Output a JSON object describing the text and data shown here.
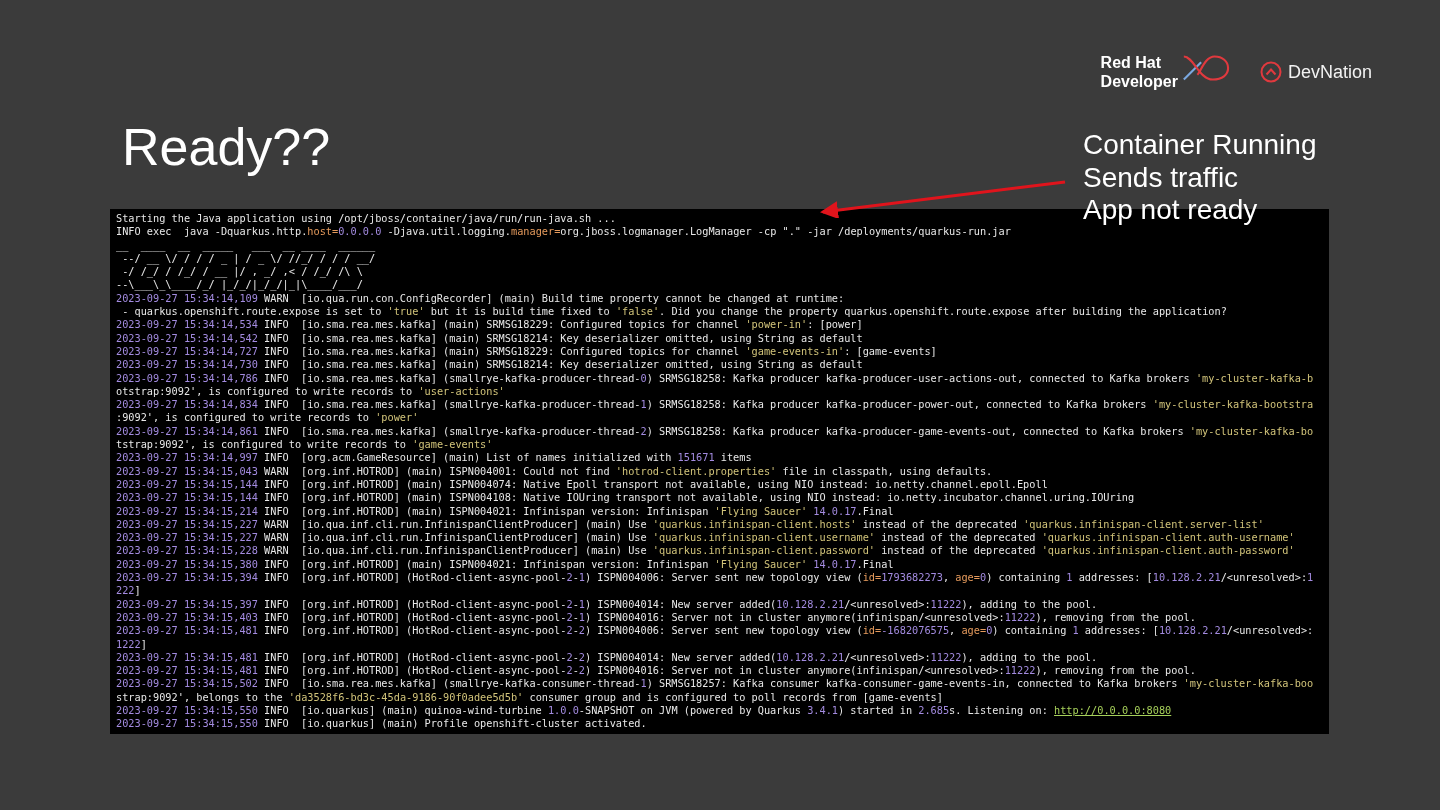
{
  "logos": {
    "developer": {
      "line_1": "Red Hat",
      "line_2": "Developer"
    },
    "devnation": "DevNation"
  },
  "title": "Ready??",
  "annotation": [
    "Container Running",
    "Sends traffic",
    "App not ready"
  ],
  "terminal": {
    "lines": [
      {
        "kind": "text",
        "segments": [
          {
            "text": "Starting the Java application using /opt/jboss/container/java/run/run-java.sh ...",
            "kind": "plain"
          }
        ]
      },
      {
        "kind": "text",
        "segments": [
          {
            "text": "INFO exec  java -Dquarkus.http.",
            "kind": "plain"
          },
          {
            "text": "host=",
            "kind": "key"
          },
          {
            "text": "0.0.0.0",
            "kind": "number"
          },
          {
            "text": " -Djava.util.logging.",
            "kind": "plain"
          },
          {
            "text": "manager=",
            "kind": "key"
          },
          {
            "text": "org.jboss.logmanager.LogManager -cp \".\" -jar /deployments/quarkus-run.jar",
            "kind": "plain"
          }
        ]
      },
      {
        "kind": "banner",
        "segments": [
          {
            "text": "__  ____  __  _____   ___  __ ____  ______",
            "kind": "plain"
          }
        ]
      },
      {
        "kind": "banner",
        "segments": [
          {
            "text": " --/ __ \\/ / / / _ | / _ \\/ //_/ / / / __/",
            "kind": "plain"
          }
        ]
      },
      {
        "kind": "banner",
        "segments": [
          {
            "text": " -/ /_/ / /_/ / __ |/ , _/ ,< / /_/ /\\ \\",
            "kind": "plain"
          }
        ]
      },
      {
        "kind": "banner",
        "segments": [
          {
            "text": "--\\___\\_\\____/_/ |_/_/|_/_/|_|\\____/___/",
            "kind": "plain"
          }
        ]
      },
      {
        "kind": "log",
        "time": "2023-09-27 15:34:14,109",
        "level": "WARN",
        "segments": [
          {
            "text": "[io.qua.run.con.ConfigRecorder] (main) Build time property cannot be changed at runtime:",
            "kind": "plain"
          }
        ]
      },
      {
        "kind": "text",
        "segments": [
          {
            "text": " - quarkus.openshift.route.expose is set to ",
            "kind": "plain"
          },
          {
            "text": "'true'",
            "kind": "string"
          },
          {
            "text": " but it is build time fixed to ",
            "kind": "plain"
          },
          {
            "text": "'false'",
            "kind": "string"
          },
          {
            "text": ". Did you change the property quarkus.openshift.route.expose after building the application?",
            "kind": "plain"
          }
        ]
      },
      {
        "kind": "log",
        "time": "2023-09-27 15:34:14,534",
        "level": "INFO",
        "segments": [
          {
            "text": "[io.sma.rea.mes.kafka] (main) SRMSG18229: Configured topics for channel ",
            "kind": "plain"
          },
          {
            "text": "'power-in'",
            "kind": "string"
          },
          {
            "text": ": [power]",
            "kind": "plain"
          }
        ]
      },
      {
        "kind": "log",
        "time": "2023-09-27 15:34:14,542",
        "level": "INFO",
        "segments": [
          {
            "text": "[io.sma.rea.mes.kafka] (main) SRMSG18214: Key deserializer omitted, using String as default",
            "kind": "plain"
          }
        ]
      },
      {
        "kind": "log",
        "time": "2023-09-27 15:34:14,727",
        "level": "INFO",
        "segments": [
          {
            "text": "[io.sma.rea.mes.kafka] (main) SRMSG18229: Configured topics for channel ",
            "kind": "plain"
          },
          {
            "text": "'game-events-in'",
            "kind": "string"
          },
          {
            "text": ": [game-events]",
            "kind": "plain"
          }
        ]
      },
      {
        "kind": "log",
        "time": "2023-09-27 15:34:14,730",
        "level": "INFO",
        "segments": [
          {
            "text": "[io.sma.rea.mes.kafka] (main) SRMSG18214: Key deserializer omitted, using String as default",
            "kind": "plain"
          }
        ]
      },
      {
        "kind": "log",
        "time": "2023-09-27 15:34:14,786",
        "level": "INFO",
        "segments": [
          {
            "text": "[io.sma.rea.mes.kafka] (smallrye-kafka-producer-thread-",
            "kind": "plain"
          },
          {
            "text": "0",
            "kind": "number"
          },
          {
            "text": ") SRMSG18258: Kafka producer kafka-producer-user-actions-out, connected to Kafka brokers ",
            "kind": "plain"
          },
          {
            "text": "'my-cluster-kafka-b",
            "kind": "string"
          }
        ]
      },
      {
        "kind": "text",
        "segments": [
          {
            "text": "otstrap:9092', is configured to write records to ",
            "kind": "plain"
          },
          {
            "text": "'user-actions'",
            "kind": "string"
          }
        ]
      },
      {
        "kind": "log",
        "time": "2023-09-27 15:34:14,834",
        "level": "INFO",
        "segments": [
          {
            "text": "[io.sma.rea.mes.kafka] (smallrye-kafka-producer-thread-",
            "kind": "plain"
          },
          {
            "text": "1",
            "kind": "number"
          },
          {
            "text": ") SRMSG18258: Kafka producer kafka-producer-power-out, connected to Kafka brokers ",
            "kind": "plain"
          },
          {
            "text": "'my-cluster-kafka-bootstra",
            "kind": "string"
          }
        ]
      },
      {
        "kind": "text",
        "segments": [
          {
            "text": ":9092', is configured to write records to ",
            "kind": "plain"
          },
          {
            "text": "'power'",
            "kind": "string"
          }
        ]
      },
      {
        "kind": "log",
        "time": "2023-09-27 15:34:14,861",
        "level": "INFO",
        "segments": [
          {
            "text": "[io.sma.rea.mes.kafka] (smallrye-kafka-producer-thread-",
            "kind": "plain"
          },
          {
            "text": "2",
            "kind": "number"
          },
          {
            "text": ") SRMSG18258: Kafka producer kafka-producer-game-events-out, connected to Kafka brokers ",
            "kind": "plain"
          },
          {
            "text": "'my-cluster-kafka-bo",
            "kind": "string"
          }
        ]
      },
      {
        "kind": "text",
        "segments": [
          {
            "text": "tstrap:9092', is configured to write records to ",
            "kind": "plain"
          },
          {
            "text": "'game-events'",
            "kind": "string"
          }
        ]
      },
      {
        "kind": "log",
        "time": "2023-09-27 15:34:14,997",
        "level": "INFO",
        "segments": [
          {
            "text": "[org.acm.GameResource] (main) List of names initialized with ",
            "kind": "plain"
          },
          {
            "text": "151671",
            "kind": "number"
          },
          {
            "text": " items",
            "kind": "plain"
          }
        ]
      },
      {
        "kind": "log",
        "time": "2023-09-27 15:34:15,043",
        "level": "WARN",
        "segments": [
          {
            "text": "[org.inf.HOTROD] (main) ISPN004001: Could not find ",
            "kind": "plain"
          },
          {
            "text": "'hotrod-client.properties'",
            "kind": "string"
          },
          {
            "text": " file in classpath, using defaults.",
            "kind": "plain"
          }
        ]
      },
      {
        "kind": "log",
        "time": "2023-09-27 15:34:15,144",
        "level": "INFO",
        "segments": [
          {
            "text": "[org.inf.HOTROD] (main) ISPN004074: Native Epoll transport not available, using NIO instead: io.netty.channel.epoll.Epoll",
            "kind": "plain"
          }
        ]
      },
      {
        "kind": "log",
        "time": "2023-09-27 15:34:15,144",
        "level": "INFO",
        "segments": [
          {
            "text": "[org.inf.HOTROD] (main) ISPN004108: Native IOUring transport not available, using NIO instead: io.netty.incubator.channel.uring.IOUring",
            "kind": "plain"
          }
        ]
      },
      {
        "kind": "log",
        "time": "2023-09-27 15:34:15,214",
        "level": "INFO",
        "segments": [
          {
            "text": "[org.inf.HOTROD] (main) ISPN004021: Infinispan version: Infinispan ",
            "kind": "plain"
          },
          {
            "text": "'Flying Saucer'",
            "kind": "string"
          },
          {
            "text": " 14.0.17",
            "kind": "number"
          },
          {
            "text": ".Final",
            "kind": "plain"
          }
        ]
      },
      {
        "kind": "log",
        "time": "2023-09-27 15:34:15,227",
        "level": "WARN",
        "segments": [
          {
            "text": "[io.qua.inf.cli.run.InfinispanClientProducer] (main) Use ",
            "kind": "plain"
          },
          {
            "text": "'quarkus.infinispan-client.hosts'",
            "kind": "string"
          },
          {
            "text": " instead of the deprecated ",
            "kind": "plain"
          },
          {
            "text": "'quarkus.infinispan-client.server-list'",
            "kind": "string"
          }
        ]
      },
      {
        "kind": "log",
        "time": "2023-09-27 15:34:15,227",
        "level": "WARN",
        "segments": [
          {
            "text": "[io.qua.inf.cli.run.InfinispanClientProducer] (main) Use ",
            "kind": "plain"
          },
          {
            "text": "'quarkus.infinispan-client.username'",
            "kind": "string"
          },
          {
            "text": " instead of the deprecated ",
            "kind": "plain"
          },
          {
            "text": "'quarkus.infinispan-client.auth-username'",
            "kind": "string"
          }
        ]
      },
      {
        "kind": "log",
        "time": "2023-09-27 15:34:15,228",
        "level": "WARN",
        "segments": [
          {
            "text": "[io.qua.inf.cli.run.InfinispanClientProducer] (main) Use ",
            "kind": "plain"
          },
          {
            "text": "'quarkus.infinispan-client.password'",
            "kind": "string"
          },
          {
            "text": " instead of the deprecated ",
            "kind": "plain"
          },
          {
            "text": "'quarkus.infinispan-client.auth-password'",
            "kind": "string"
          }
        ]
      },
      {
        "kind": "log",
        "time": "2023-09-27 15:34:15,380",
        "level": "INFO",
        "segments": [
          {
            "text": "[org.inf.HOTROD] (main) ISPN004021: Infinispan version: Infinispan ",
            "kind": "plain"
          },
          {
            "text": "'Flying Saucer'",
            "kind": "string"
          },
          {
            "text": " 14.0.17",
            "kind": "number"
          },
          {
            "text": ".Final",
            "kind": "plain"
          }
        ]
      },
      {
        "kind": "log",
        "time": "2023-09-27 15:34:15,394",
        "level": "INFO",
        "segments": [
          {
            "text": "[org.inf.HOTROD] (HotRod-client-async-pool-",
            "kind": "plain"
          },
          {
            "text": "2",
            "kind": "number"
          },
          {
            "text": "-",
            "kind": "plain"
          },
          {
            "text": "1",
            "kind": "number"
          },
          {
            "text": ") ISPN004006: Server sent new topology view (",
            "kind": "plain"
          },
          {
            "text": "id=",
            "kind": "key"
          },
          {
            "text": "1793682273",
            "kind": "number"
          },
          {
            "text": ", ",
            "kind": "plain"
          },
          {
            "text": "age=",
            "kind": "key"
          },
          {
            "text": "0",
            "kind": "number"
          },
          {
            "text": ") containing ",
            "kind": "plain"
          },
          {
            "text": "1",
            "kind": "number"
          },
          {
            "text": " addresses: [",
            "kind": "plain"
          },
          {
            "text": "10.128.2.21",
            "kind": "number"
          },
          {
            "text": "/<unresolved>:",
            "kind": "plain"
          },
          {
            "text": "1",
            "kind": "number"
          }
        ]
      },
      {
        "kind": "text",
        "segments": [
          {
            "text": "222",
            "kind": "number"
          },
          {
            "text": "]",
            "kind": "plain"
          }
        ]
      },
      {
        "kind": "log",
        "time": "2023-09-27 15:34:15,397",
        "level": "INFO",
        "segments": [
          {
            "text": "[org.inf.HOTROD] (HotRod-client-async-pool-",
            "kind": "plain"
          },
          {
            "text": "2",
            "kind": "number"
          },
          {
            "text": "-",
            "kind": "plain"
          },
          {
            "text": "1",
            "kind": "number"
          },
          {
            "text": ") ISPN004014: New server added(",
            "kind": "plain"
          },
          {
            "text": "10.128.2.21",
            "kind": "number"
          },
          {
            "text": "/<unresolved>:",
            "kind": "plain"
          },
          {
            "text": "11222",
            "kind": "number"
          },
          {
            "text": "), adding to the pool.",
            "kind": "plain"
          }
        ]
      },
      {
        "kind": "log",
        "time": "2023-09-27 15:34:15,403",
        "level": "INFO",
        "segments": [
          {
            "text": "[org.inf.HOTROD] (HotRod-client-async-pool-",
            "kind": "plain"
          },
          {
            "text": "2",
            "kind": "number"
          },
          {
            "text": "-",
            "kind": "plain"
          },
          {
            "text": "1",
            "kind": "number"
          },
          {
            "text": ") ISPN004016: Server not in cluster anymore(infinispan/<unresolved>:",
            "kind": "plain"
          },
          {
            "text": "11222",
            "kind": "number"
          },
          {
            "text": "), removing from the pool.",
            "kind": "plain"
          }
        ]
      },
      {
        "kind": "log",
        "time": "2023-09-27 15:34:15,481",
        "level": "INFO",
        "segments": [
          {
            "text": "[org.inf.HOTROD] (HotRod-client-async-pool-",
            "kind": "plain"
          },
          {
            "text": "2",
            "kind": "number"
          },
          {
            "text": "-",
            "kind": "plain"
          },
          {
            "text": "2",
            "kind": "number"
          },
          {
            "text": ") ISPN004006: Server sent new topology view (",
            "kind": "plain"
          },
          {
            "text": "id=",
            "kind": "key"
          },
          {
            "text": "-1682076575",
            "kind": "number"
          },
          {
            "text": ", ",
            "kind": "plain"
          },
          {
            "text": "age=",
            "kind": "key"
          },
          {
            "text": "0",
            "kind": "number"
          },
          {
            "text": ") containing ",
            "kind": "plain"
          },
          {
            "text": "1",
            "kind": "number"
          },
          {
            "text": " addresses: [",
            "kind": "plain"
          },
          {
            "text": "10.128.2.21",
            "kind": "number"
          },
          {
            "text": "/<unresolved>:",
            "kind": "plain"
          }
        ]
      },
      {
        "kind": "text",
        "segments": [
          {
            "text": "1222",
            "kind": "number"
          },
          {
            "text": "]",
            "kind": "plain"
          }
        ]
      },
      {
        "kind": "log",
        "time": "2023-09-27 15:34:15,481",
        "level": "INFO",
        "segments": [
          {
            "text": "[org.inf.HOTROD] (HotRod-client-async-pool-",
            "kind": "plain"
          },
          {
            "text": "2",
            "kind": "number"
          },
          {
            "text": "-",
            "kind": "plain"
          },
          {
            "text": "2",
            "kind": "number"
          },
          {
            "text": ") ISPN004014: New server added(",
            "kind": "plain"
          },
          {
            "text": "10.128.2.21",
            "kind": "number"
          },
          {
            "text": "/<unresolved>:",
            "kind": "plain"
          },
          {
            "text": "11222",
            "kind": "number"
          },
          {
            "text": "), adding to the pool.",
            "kind": "plain"
          }
        ]
      },
      {
        "kind": "log",
        "time": "2023-09-27 15:34:15,481",
        "level": "INFO",
        "segments": [
          {
            "text": "[org.inf.HOTROD] (HotRod-client-async-pool-",
            "kind": "plain"
          },
          {
            "text": "2",
            "kind": "number"
          },
          {
            "text": "-",
            "kind": "plain"
          },
          {
            "text": "2",
            "kind": "number"
          },
          {
            "text": ") ISPN004016: Server not in cluster anymore(infinispan/<unresolved>:",
            "kind": "plain"
          },
          {
            "text": "11222",
            "kind": "number"
          },
          {
            "text": "), removing from the pool.",
            "kind": "plain"
          }
        ]
      },
      {
        "kind": "log",
        "time": "2023-09-27 15:34:15,502",
        "level": "INFO",
        "segments": [
          {
            "text": "[io.sma.rea.mes.kafka] (smallrye-kafka-consumer-thread-",
            "kind": "plain"
          },
          {
            "text": "1",
            "kind": "number"
          },
          {
            "text": ") SRMSG18257: Kafka consumer kafka-consumer-game-events-in, connected to Kafka brokers ",
            "kind": "plain"
          },
          {
            "text": "'my-cluster-kafka-boo",
            "kind": "string"
          }
        ]
      },
      {
        "kind": "text",
        "segments": [
          {
            "text": "strap:9092', belongs to the ",
            "kind": "plain"
          },
          {
            "text": "'da3528f6-bd3c-45da-9186-90f0adee5d5b'",
            "kind": "string"
          },
          {
            "text": " consumer group and is configured to poll records from [game-events]",
            "kind": "plain"
          }
        ]
      },
      {
        "kind": "log",
        "time": "2023-09-27 15:34:15,550",
        "level": "INFO",
        "segments": [
          {
            "text": "[io.quarkus] (main) quinoa-wind-turbine ",
            "kind": "plain"
          },
          {
            "text": "1.0.0",
            "kind": "number"
          },
          {
            "text": "-SNAPSHOT on JVM (powered by Quarkus ",
            "kind": "plain"
          },
          {
            "text": "3.4.1",
            "kind": "number"
          },
          {
            "text": ") started in ",
            "kind": "plain"
          },
          {
            "text": "2.685",
            "kind": "number"
          },
          {
            "text": "s. Listening on: ",
            "kind": "plain"
          },
          {
            "text": "http://0.0.0.0:8080",
            "kind": "link"
          }
        ]
      },
      {
        "kind": "log",
        "time": "2023-09-27 15:34:15,550",
        "level": "INFO",
        "segments": [
          {
            "text": "[io.quarkus] (main) Profile openshift-cluster activated.",
            "kind": "plain"
          }
        ]
      }
    ]
  }
}
